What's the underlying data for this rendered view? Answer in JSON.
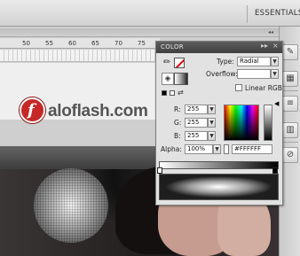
{
  "workspace": {
    "label": "ESSENTIALS"
  },
  "timeline": {
    "ticks": [
      "50",
      "55",
      "60",
      "65",
      "70",
      "75"
    ]
  },
  "logo": {
    "mark": "f",
    "text": "aloflash.com"
  },
  "color_panel": {
    "title": "COLOR",
    "menu_glyph": "▸▸",
    "close_glyph": "×",
    "type_label": "Type:",
    "type_value": "Radial",
    "overflow_label": "Overflow:",
    "linear_rgb_label": "Linear RGB",
    "linear_rgb_checked": false,
    "r_label": "R:",
    "r_value": "255",
    "g_label": "G:",
    "g_value": "255",
    "b_label": "B:",
    "b_value": "255",
    "alpha_label": "Alpha:",
    "alpha_value": "100%",
    "hex_value": "#FFFFFF",
    "gradient": {
      "type": "radial",
      "stops": [
        "#FFFFFF",
        "#000000"
      ]
    }
  },
  "dock": {
    "icons": [
      "brush-icon",
      "swatches-icon",
      "align-icon",
      "library-icon",
      "transform-icon"
    ]
  },
  "colors": {
    "panel_header": "#4a4a4a",
    "panel_bg": "#e2e2e2",
    "logo_red": "#c62828"
  }
}
